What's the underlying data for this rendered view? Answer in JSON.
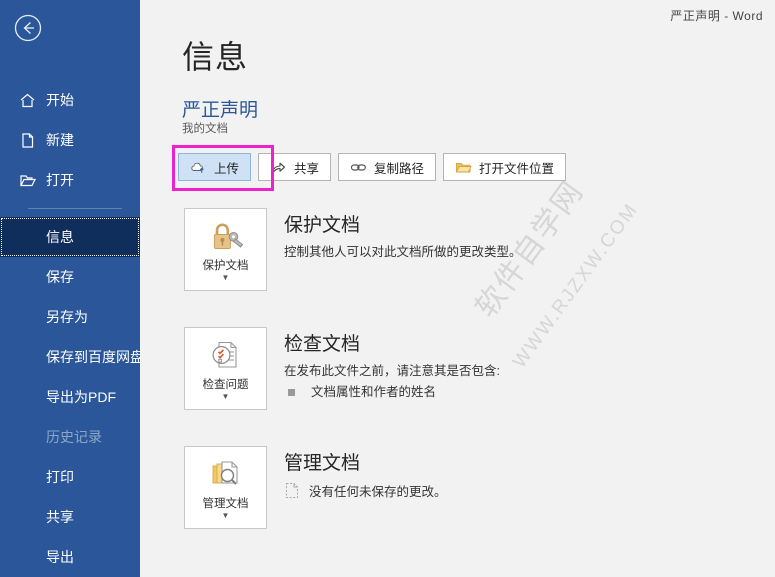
{
  "window": {
    "titlebar": "严正声明  -  Word"
  },
  "sidebar": {
    "back_icon": "back-arrow-icon",
    "items": [
      {
        "label": "开始",
        "icon": "home-icon",
        "state": "normal"
      },
      {
        "label": "新建",
        "icon": "new-document-icon",
        "state": "normal"
      },
      {
        "label": "打开",
        "icon": "open-folder-icon",
        "state": "normal"
      },
      {
        "label": "信息",
        "icon": "",
        "state": "selected"
      },
      {
        "label": "保存",
        "icon": "",
        "state": "normal"
      },
      {
        "label": "另存为",
        "icon": "",
        "state": "normal"
      },
      {
        "label": "保存到百度网盘",
        "icon": "",
        "state": "normal"
      },
      {
        "label": "导出为PDF",
        "icon": "",
        "state": "normal"
      },
      {
        "label": "历史记录",
        "icon": "",
        "state": "disabled"
      },
      {
        "label": "打印",
        "icon": "",
        "state": "normal"
      },
      {
        "label": "共享",
        "icon": "",
        "state": "normal"
      },
      {
        "label": "导出",
        "icon": "",
        "state": "normal"
      }
    ]
  },
  "main": {
    "page_title": "信息",
    "document_name": "严正声明",
    "document_location": "我的文档",
    "quick_actions": [
      {
        "label": "上传",
        "icon": "cloud-upload-icon",
        "active": true
      },
      {
        "label": "共享",
        "icon": "share-icon",
        "active": false
      },
      {
        "label": "复制路径",
        "icon": "link-icon",
        "active": false
      },
      {
        "label": "打开文件位置",
        "icon": "folder-icon",
        "active": false
      }
    ],
    "sections": [
      {
        "button_label": "保护文档",
        "button_icon": "lock-key-icon",
        "heading": "保护文档",
        "description": "控制其他人可以对此文档所做的更改类型。",
        "bullets": []
      },
      {
        "button_label": "检查问题",
        "button_icon": "inspect-document-icon",
        "heading": "检查文档",
        "description": "在发布此文件之前，请注意其是否包含:",
        "bullets": [
          "文档属性和作者的姓名"
        ]
      },
      {
        "button_label": "管理文档",
        "button_icon": "manage-document-icon",
        "heading": "管理文档",
        "description": "没有任何未保存的更改。",
        "bullets": []
      }
    ]
  },
  "watermark": {
    "line1": "软件自学网",
    "line2": "WWW.RJZXW.COM"
  },
  "colors": {
    "sidebar_bg": "#2b579a",
    "sidebar_selected": "#0f2e5c",
    "content_bg": "#f2f2f2",
    "accent_blue": "#2b579a",
    "annotation": "#ee22cc",
    "active_button_fill": "#cfe1f5"
  }
}
